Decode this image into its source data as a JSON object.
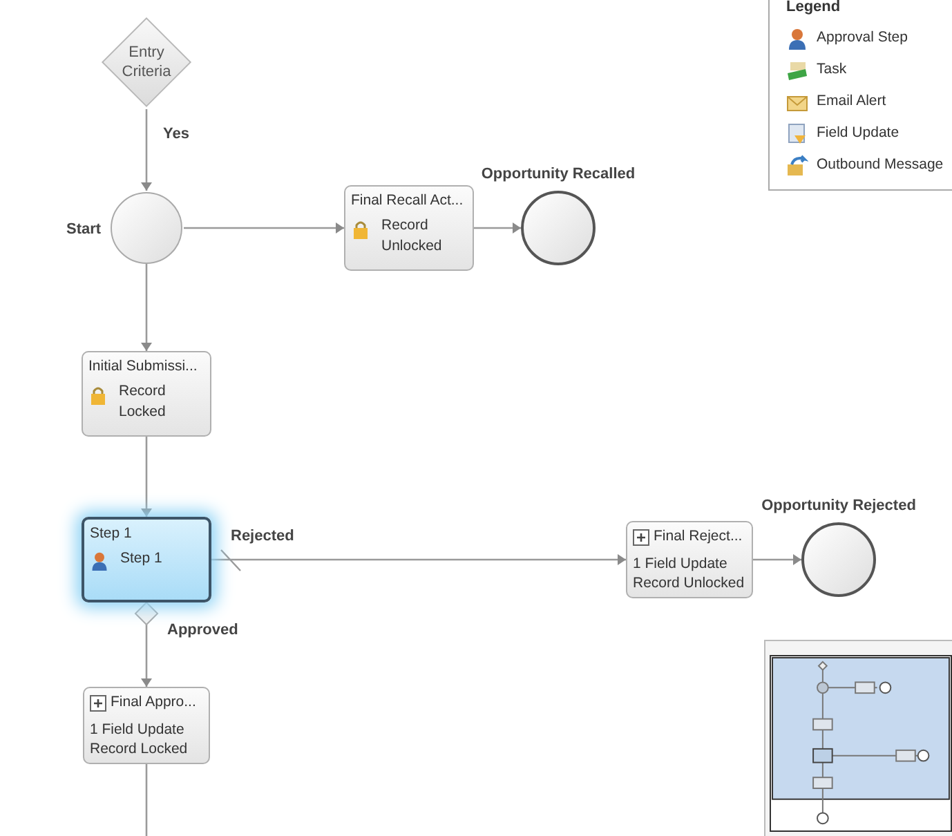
{
  "legend": {
    "title": "Legend",
    "items": [
      {
        "kind": "approval",
        "label": "Approval Step"
      },
      {
        "kind": "task",
        "label": "Task"
      },
      {
        "kind": "email",
        "label": "Email Alert"
      },
      {
        "kind": "field",
        "label": "Field Update"
      },
      {
        "kind": "outbound",
        "label": "Outbound Message"
      }
    ]
  },
  "nodes": [
    {
      "kind": "decision",
      "label": "Entry Criteria"
    },
    {
      "kind": "start",
      "label": "Start"
    },
    {
      "kind": "lock_action",
      "title": "Final Recall Act...",
      "lines": [
        "Record Unlocked"
      ]
    },
    {
      "kind": "end",
      "label": "Opportunity Recalled"
    },
    {
      "kind": "lock_action",
      "title": "Initial Submissi...",
      "lines": [
        "Record Locked"
      ]
    },
    {
      "kind": "step",
      "title": "Step 1",
      "lines": [
        "Step 1"
      ],
      "selected": true
    },
    {
      "kind": "update_action",
      "title": "Final Reject...",
      "lines": [
        "1 Field Update",
        "Record Unlocked"
      ]
    },
    {
      "kind": "end",
      "label": "Opportunity Rejected"
    },
    {
      "kind": "update_action",
      "title": "Final Appro...",
      "lines": [
        "1 Field Update",
        "Record Locked"
      ]
    }
  ],
  "edge_labels": [
    "Yes",
    "Rejected",
    "Approved"
  ]
}
